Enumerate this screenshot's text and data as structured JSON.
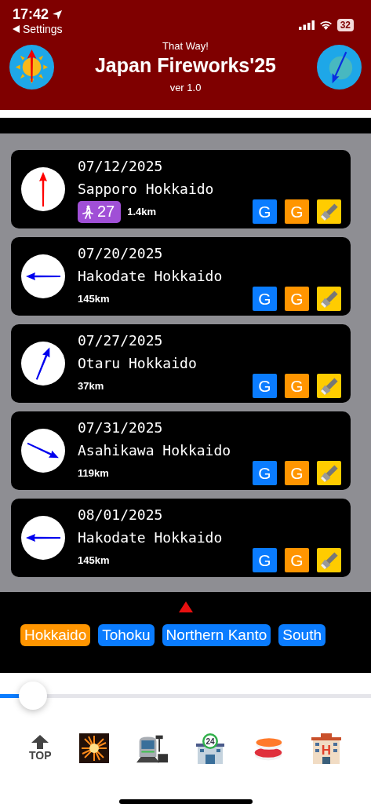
{
  "status_bar": {
    "time": "17:42",
    "back": "Settings",
    "battery": "32"
  },
  "header": {
    "subtitle": "That Way!",
    "title": "Japan Fireworks'25",
    "version": "ver 1.0"
  },
  "events": [
    {
      "date": "07/12/2025",
      "place": "Sapporo Hokkaido",
      "walk_minutes": "27",
      "distance": "1.4km",
      "kind": "north",
      "color": "#ff0000",
      "buttons": [
        {
          "label": "G",
          "color": "#0a7cff"
        },
        {
          "label": "G",
          "color": "#ff9500"
        },
        {
          "kind": "flashlight",
          "color": "#ffcc00"
        }
      ]
    },
    {
      "date": "07/20/2025",
      "place": "Hakodate Hokkaido",
      "distance": "145km",
      "kind": "west",
      "color": "#0000ee",
      "buttons": [
        {
          "label": "G",
          "color": "#0a7cff"
        },
        {
          "label": "G",
          "color": "#ff9500"
        },
        {
          "kind": "flashlight",
          "color": "#ffcc00"
        }
      ]
    },
    {
      "date": "07/27/2025",
      "place": "Otaru Hokkaido",
      "distance": "37km",
      "kind": "northeast",
      "color": "#0000ee",
      "buttons": [
        {
          "label": "G",
          "color": "#0a7cff"
        },
        {
          "label": "G",
          "color": "#ff9500"
        },
        {
          "kind": "flashlight",
          "color": "#ffcc00"
        }
      ]
    },
    {
      "date": "07/31/2025",
      "place": "Asahikawa Hokkaido",
      "distance": "119km",
      "kind": "southeast",
      "color": "#0000ee",
      "buttons": [
        {
          "label": "G",
          "color": "#0a7cff"
        },
        {
          "label": "G",
          "color": "#ff9500"
        },
        {
          "kind": "flashlight",
          "color": "#ffcc00"
        }
      ]
    },
    {
      "date": "08/01/2025",
      "place": "Hakodate Hokkaido",
      "distance": "145km",
      "kind": "west",
      "color": "#0000ee",
      "buttons": [
        {
          "label": "G",
          "color": "#0a7cff"
        },
        {
          "label": "G",
          "color": "#ff9500"
        },
        {
          "kind": "flashlight",
          "color": "#ffcc00"
        }
      ]
    }
  ],
  "regions": [
    {
      "label": "Hokkaido",
      "selected": true
    },
    {
      "label": "Tohoku",
      "selected": false
    },
    {
      "label": "Northern Kanto",
      "selected": false
    },
    {
      "label": "South",
      "selected": false
    }
  ],
  "slider": {
    "level": 0.09
  },
  "bottom_bar": [
    {
      "kind": "top",
      "label": "TOP"
    },
    {
      "kind": "fireworks"
    },
    {
      "kind": "train"
    },
    {
      "kind": "store",
      "label": "24"
    },
    {
      "kind": "sushi"
    },
    {
      "kind": "hotel",
      "label": "H"
    }
  ]
}
